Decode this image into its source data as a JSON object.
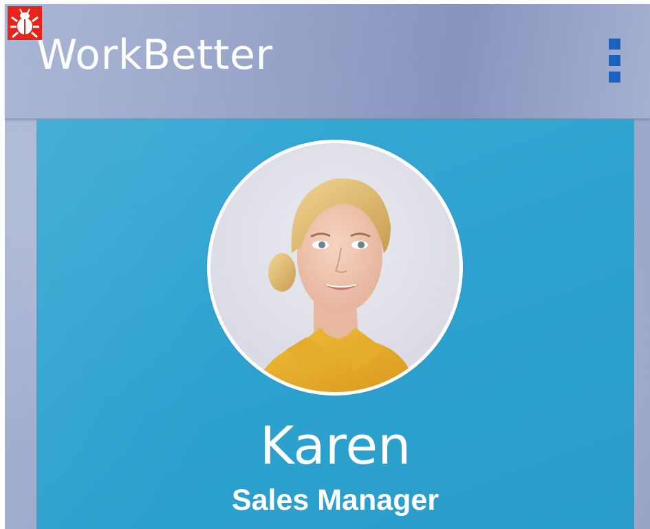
{
  "app": {
    "title": "WorkBetter",
    "debug_icon": "bug-icon",
    "menu_icon": "more-vert-icon"
  },
  "profile": {
    "name": "Karen",
    "role": "Sales Manager",
    "avatar": "avatar-photo"
  },
  "colors": {
    "card": "#2ea2cf",
    "menu_icon": "#1565c0",
    "debug_badge": "#e8231b",
    "text": "#ffffff"
  }
}
